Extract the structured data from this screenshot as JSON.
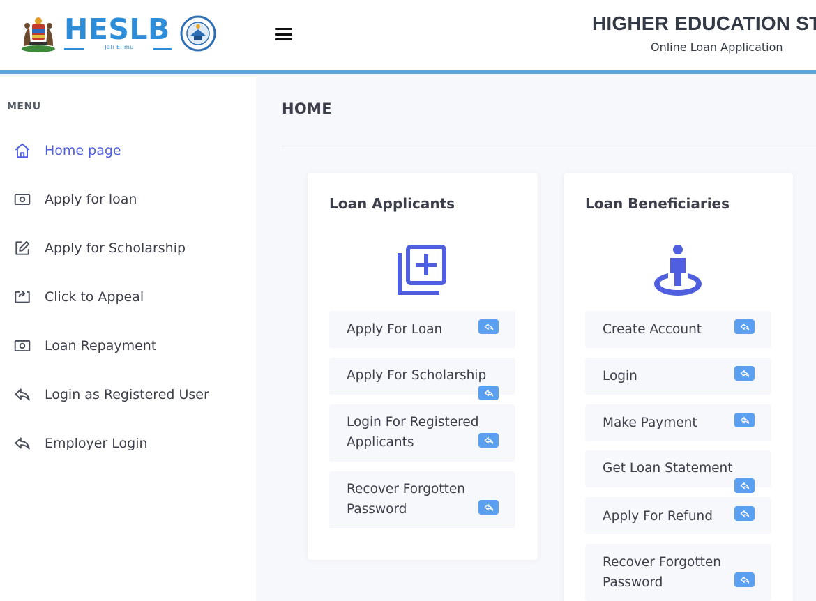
{
  "header": {
    "brand": "HESLB",
    "brand_tagline": "Jali Elimu",
    "title": "HIGHER EDUCATION ST",
    "subtitle": "Online Loan Application"
  },
  "sidebar": {
    "menu_label": "MENU",
    "items": [
      {
        "label": "Home page",
        "icon": "home-icon",
        "active": true
      },
      {
        "label": "Apply for loan",
        "icon": "cash-icon"
      },
      {
        "label": "Apply for Scholarship",
        "icon": "edit-icon"
      },
      {
        "label": "Click to Appeal",
        "icon": "share-box-icon"
      },
      {
        "label": "Loan Repayment",
        "icon": "cash-icon"
      },
      {
        "label": "Login as Registered User",
        "icon": "reply-icon"
      },
      {
        "label": "Employer Login",
        "icon": "reply-icon"
      }
    ]
  },
  "main": {
    "page_title": "HOME",
    "cards": [
      {
        "title": "Loan Applicants",
        "icon": "add-stack-icon",
        "items": [
          "Apply For Loan",
          "Apply For Scholarship",
          "Login For Registered Applicants",
          "Recover Forgotten Password"
        ]
      },
      {
        "title": "Loan Beneficiaries",
        "icon": "person-location-icon",
        "items": [
          "Create Account",
          "Login",
          "Make Payment",
          "Get Loan Statement",
          "Apply For Refund",
          "Recover Forgotten Password"
        ]
      }
    ]
  },
  "colors": {
    "accent": "#4f5fe0",
    "brand_blue": "#2e8dd8",
    "header_border": "#5aa7db",
    "badge": "#5b9ff0"
  }
}
